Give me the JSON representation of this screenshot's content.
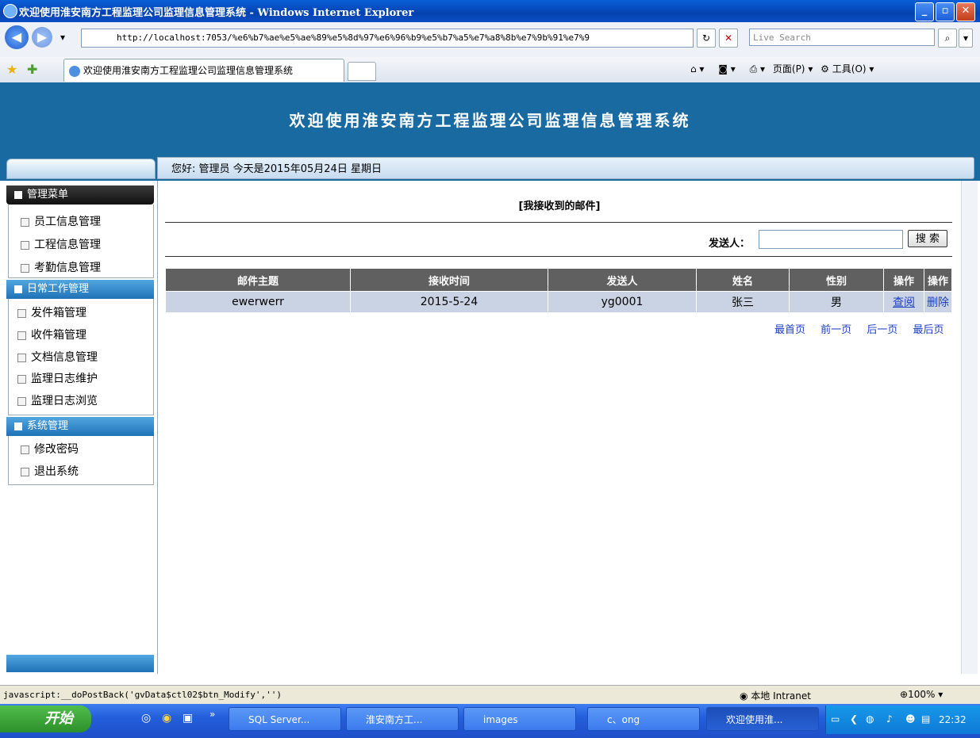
{
  "window": {
    "title": "欢迎使用淮安南方工程监理公司监理信息管理系统 - Windows Internet Explorer"
  },
  "browser": {
    "address": "http://localhost:7053/%e6%b7%ae%e5%ae%89%e5%8d%97%e6%96%b9%e5%b7%a5%e7%a8%8b%e7%9b%91%e7%9",
    "search_placeholder": "Live Search",
    "tab_title": "欢迎使用淮安南方工程监理公司监理信息管理系统",
    "page_menu": "页面(P)",
    "tools_menu": "工具(O)"
  },
  "app": {
    "title": "欢迎使用淮安南方工程监理公司监理信息管理系统",
    "greeting": "您好: 管理员   今天是2015年05月24日   星期日"
  },
  "sidebar": {
    "main_menu_label": "管理菜单",
    "main_items": [
      "员工信息管理",
      "工程信息管理",
      "考勤信息管理"
    ],
    "daily_label": "日常工作管理",
    "daily_items": [
      "发件箱管理",
      "收件箱管理",
      "文档信息管理",
      "监理日志维护",
      "监理日志浏览"
    ],
    "system_label": "系统管理",
    "system_items": [
      "修改密码",
      "退出系统"
    ]
  },
  "main": {
    "heading": "[我接收到的邮件]",
    "sender_label": "发送人：",
    "sender_value": "",
    "search_button": "搜 索",
    "columns": [
      "邮件主题",
      "接收时间",
      "发送人",
      "姓名",
      "性别",
      "操作",
      "操作"
    ],
    "rows": [
      {
        "subject": "ewerwerr",
        "time": "2015-5-24",
        "sender": "yg0001",
        "name": "张三",
        "gender": "男",
        "op1": "查阅",
        "op2": "删除"
      }
    ],
    "pager": [
      "最首页",
      "前一页",
      "后一页",
      "最后页"
    ]
  },
  "status": {
    "text": "javascript:__doPostBack('gvData$ctl02$btn_Modify','')",
    "zone": "本地 Intranet",
    "zoom": "100%"
  },
  "taskbar": {
    "start": "开始",
    "items": [
      "SQL Server...",
      "淮安南方工...",
      "images",
      "c、ong",
      "欢迎使用淮..."
    ],
    "clock": "22:32"
  }
}
